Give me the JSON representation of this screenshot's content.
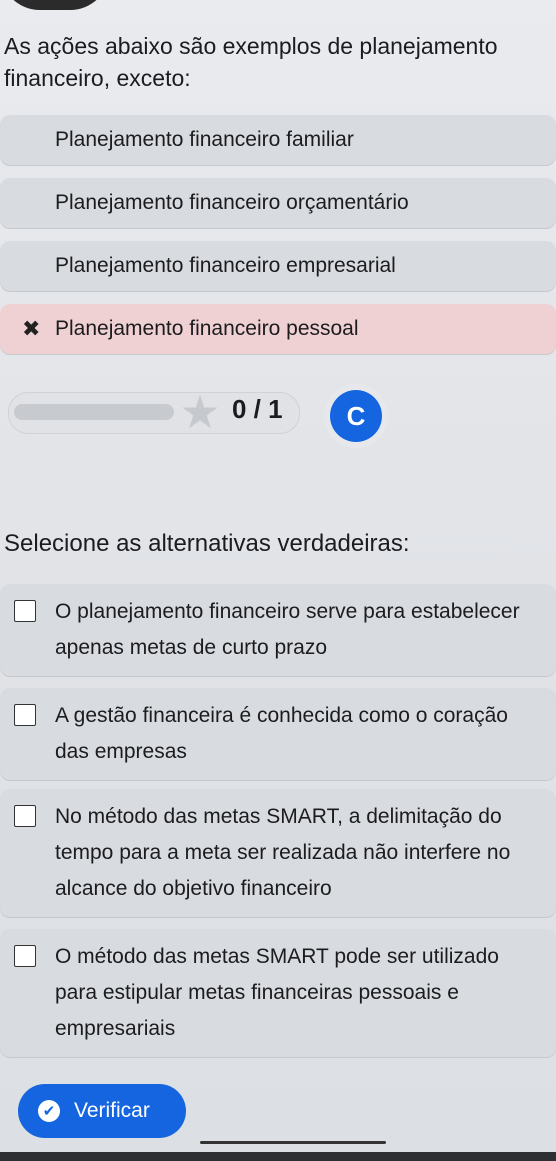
{
  "question": {
    "title": "As ações abaixo são exemplos de planejamento financeiro, exceto:"
  },
  "options": [
    {
      "label": "Planejamento financeiro familiar"
    },
    {
      "label": "Planejamento financeiro orçamentário"
    },
    {
      "label": "Planejamento financeiro empresarial"
    },
    {
      "label": "Planejamento financeiro pessoal",
      "state": "wrong"
    }
  ],
  "score": {
    "text": "0 / 1",
    "retry_icon": "C"
  },
  "section": {
    "title": "Selecione as alternativas verdadeiras:"
  },
  "checkboxes": [
    {
      "label": "O planejamento financeiro serve para estabelecer apenas metas de curto prazo",
      "checked": false
    },
    {
      "label": "A gestão financeira é conhecida como o coração das empresas",
      "checked": false
    },
    {
      "label": "No método das metas SMART, a delimitação do tempo para a meta ser realizada não interfere no alcance do objetivo financeiro",
      "checked": false
    },
    {
      "label": "O método das metas SMART pode ser utilizado para estipular metas financeiras pessoais e empresariais",
      "checked": false
    }
  ],
  "verify_button": {
    "label": "Verificar"
  },
  "colors": {
    "accent": "#1565e0",
    "wrong_bg": "#f0d1d3",
    "option_bg": "#d8dbdf"
  }
}
